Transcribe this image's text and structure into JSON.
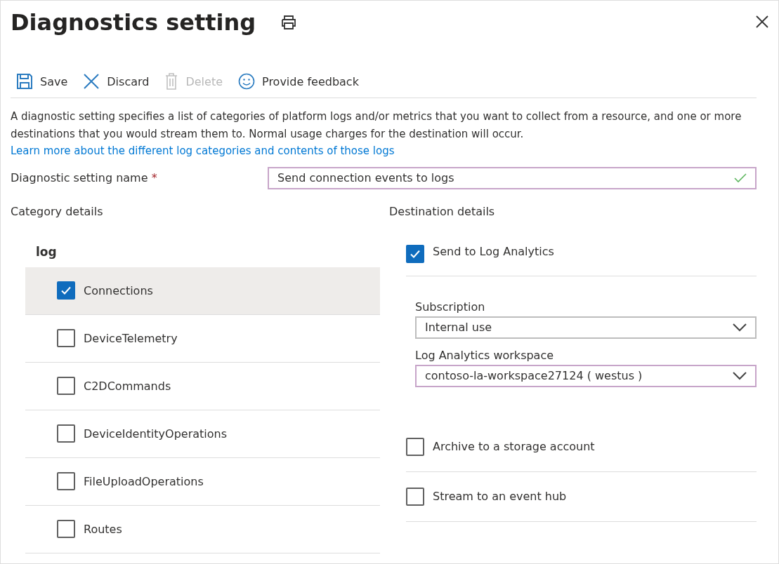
{
  "window": {
    "title": "Diagnostics setting"
  },
  "toolbar": [
    {
      "kind": "save",
      "label": "Save",
      "disabled": false
    },
    {
      "kind": "discard",
      "label": "Discard",
      "disabled": false
    },
    {
      "kind": "delete",
      "label": "Delete",
      "disabled": true
    },
    {
      "kind": "feedback",
      "label": "Provide feedback",
      "disabled": false
    }
  ],
  "description": {
    "text": "A diagnostic setting specifies a list of categories of platform logs and/or metrics that you want to collect from a resource, and one or more destinations that you would stream them to. Normal usage charges for the destination will occur.",
    "link": "Learn more about the different log categories and contents of those logs"
  },
  "name_field": {
    "label": "Diagnostic setting name",
    "required_mark": "*",
    "value": "Send connection events to logs",
    "valid": true
  },
  "category_details": {
    "heading": "Category details",
    "group": "log",
    "items": [
      {
        "label": "Connections",
        "checked": true,
        "selected": true
      },
      {
        "label": "DeviceTelemetry",
        "checked": false,
        "selected": false
      },
      {
        "label": "C2DCommands",
        "checked": false,
        "selected": false
      },
      {
        "label": "DeviceIdentityOperations",
        "checked": false,
        "selected": false
      },
      {
        "label": "FileUploadOperations",
        "checked": false,
        "selected": false
      },
      {
        "label": "Routes",
        "checked": false,
        "selected": false
      }
    ]
  },
  "destination_details": {
    "heading": "Destination details",
    "destinations": [
      {
        "label": "Send to Log Analytics",
        "checked": true,
        "fields": [
          {
            "label": "Subscription",
            "value": "Internal use",
            "focused": false
          },
          {
            "label": "Log Analytics workspace",
            "value": "contoso-la-workspace27124 ( westus )",
            "focused": true
          }
        ]
      },
      {
        "label": "Archive to a storage account",
        "checked": false
      },
      {
        "label": "Stream to an event hub",
        "checked": false
      }
    ]
  }
}
